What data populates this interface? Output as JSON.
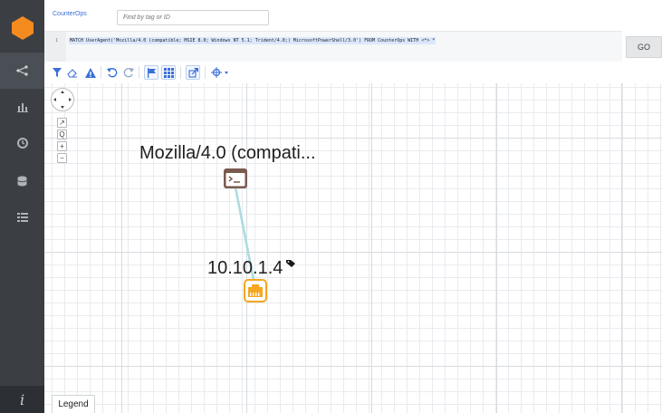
{
  "header": {
    "database_name": "CounterOps",
    "search_placeholder": "Find by tag or ID"
  },
  "editor": {
    "line_number": "1",
    "query_text": "MATCH UserAgent('Mozilla/4.0 (compatible; MSIE 8.0; Windows NT 5.1; Trident/4.0;) MicrosoftPowerShell/3.0') FROM CounterOps WITH <*> *",
    "go_label": "GO"
  },
  "sidebar": {
    "items": [
      {
        "icon": "share-icon"
      },
      {
        "icon": "bar-chart-icon"
      },
      {
        "icon": "clock-icon"
      },
      {
        "icon": "database-icon"
      },
      {
        "icon": "list-icon"
      }
    ],
    "footer_label": "i"
  },
  "toolbar": {
    "icons": [
      "filter-icon",
      "eraser-icon",
      "warning-icon",
      "undo-icon",
      "redo-icon",
      "flag-icon",
      "grid-icon",
      "export-icon",
      "layout-icon"
    ]
  },
  "canvas": {
    "zoom_controls": [
      "↗",
      "Q",
      "+",
      "−"
    ],
    "nodes": [
      {
        "label": "Mozilla/4.0 (compati...",
        "icon": "terminal-icon",
        "color": "#7a5a4e"
      },
      {
        "label": "10.10.1.4",
        "icon": "ethernet-port-icon",
        "color": "#f5a623",
        "tag_icon": "tag-icon"
      }
    ],
    "edge_color": "#a9dbe0"
  },
  "legend": {
    "label": "Legend"
  },
  "colors": {
    "sidebar": "#3b3f44",
    "logo": "#f58a1f",
    "accent": "#3a6fd8"
  }
}
